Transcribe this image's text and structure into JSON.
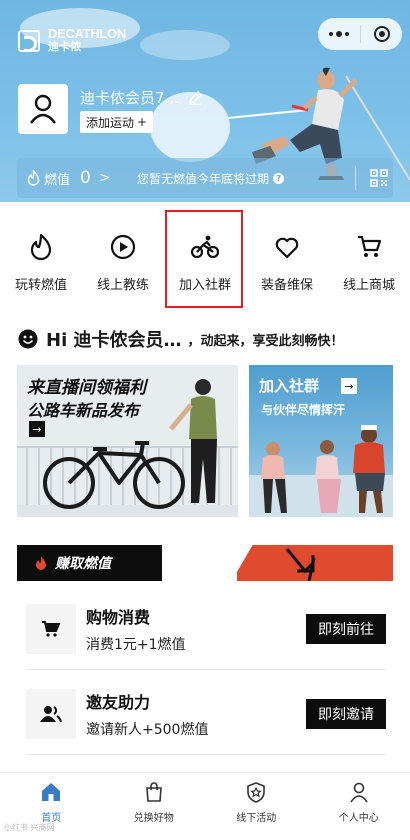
{
  "brand": {
    "name_en": "DECATHLON",
    "name_cn": "迪卡侬"
  },
  "user": {
    "name": "迪卡侬会员7…",
    "add_sport_label": "添加运动",
    "add_sport_icon": "+"
  },
  "fuel": {
    "label": "燃值",
    "value": "0",
    "arrow": ">",
    "note": "您暂无燃值今年底将过期",
    "help_icon": "?"
  },
  "nav": {
    "items": [
      {
        "label": "玩转燃值",
        "icon": "flame-icon"
      },
      {
        "label": "线上教练",
        "icon": "play-circle-icon"
      },
      {
        "label": "加入社群",
        "icon": "cyclist-icon"
      },
      {
        "label": "装备维保",
        "icon": "heart-icon"
      },
      {
        "label": "线上商城",
        "icon": "cart-icon"
      }
    ]
  },
  "greeting": {
    "main": "Hi 迪卡侬会员…",
    "sub": "，动起来，享受此刻畅快！"
  },
  "banners": {
    "left": {
      "line1": "来直播间领福利",
      "line2": "公路车新品发布",
      "arrow": "→"
    },
    "right": {
      "line1": "加入社群",
      "line2": "与伙伴尽情挥汗",
      "arrow": "→"
    }
  },
  "earn": {
    "title": "赚取燃值",
    "tasks": [
      {
        "title": "购物消费",
        "desc": "消费1元+1燃值",
        "button": "即刻前往",
        "icon": "cart-icon"
      },
      {
        "title": "邀友助力",
        "desc": "邀请新人+500燃值",
        "button": "即刻邀请",
        "icon": "users-icon"
      }
    ]
  },
  "tabbar": {
    "tabs": [
      {
        "label": "首页",
        "icon": "home-icon",
        "active": true
      },
      {
        "label": "兑换好物",
        "icon": "shopping-bag-icon",
        "active": false
      },
      {
        "label": "线下活动",
        "icon": "shield-star-icon",
        "active": false
      },
      {
        "label": "个人中心",
        "icon": "user-icon",
        "active": false
      }
    ]
  },
  "watermark": "小红书 兴商网",
  "colors": {
    "accent_blue": "#3a7cc4",
    "highlight_red": "#e02020",
    "earn_orange": "#e04a2e",
    "hero_blue": "#7cc0e8"
  }
}
